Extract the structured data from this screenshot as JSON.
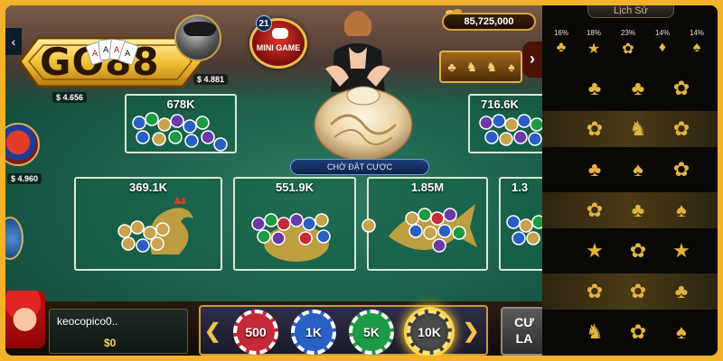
{
  "logo": {
    "text": "GO88"
  },
  "mini_game": {
    "badge": "21",
    "label": "MINI GAME"
  },
  "jackpot": {
    "amount": "85,725,000"
  },
  "avatars": {
    "top_player_money": "$ 4.656",
    "second_player_money": "$ 4.881",
    "left_player_money": "$ 4.960"
  },
  "status": {
    "text": "CHỜ ĐẶT CƯỢC"
  },
  "bets": {
    "top_left": "678K",
    "top_right": "716.6K",
    "rooster": "369.1K",
    "gourd": "551.9K",
    "fish": "1.85M",
    "crab_partial": "1.3"
  },
  "player": {
    "name": "keocopico0..",
    "balance": "$0"
  },
  "chips": [
    {
      "label": "500",
      "color": "#c42a37"
    },
    {
      "label": "1K",
      "color": "#2a5fc4"
    },
    {
      "label": "5K",
      "color": "#1d9a45"
    },
    {
      "label": "10K",
      "color": "#4a4a4a",
      "selected": true
    }
  ],
  "action": {
    "label_line1": "CƯ",
    "label_line2": "LA"
  },
  "history": {
    "title": "Lịch Sử",
    "percentages": [
      "16%",
      "18%",
      "23%",
      "14%",
      "14%"
    ],
    "rows": [
      [
        "gourd",
        "gourd",
        "shrimp"
      ],
      [
        "shrimp",
        "deer",
        "shrimp"
      ],
      [
        "gourd",
        "rooster",
        "shrimp"
      ],
      [
        "shrimp",
        "gourd",
        "rooster"
      ],
      [
        "crab",
        "shrimp",
        "crab"
      ],
      [
        "shrimp",
        "shrimp",
        "gourd"
      ],
      [
        "deer",
        "shrimp",
        "rooster"
      ]
    ]
  },
  "colors": {
    "felt": "#1a5b49",
    "gold": "#e2b43e",
    "frame": "#f3b22c"
  }
}
